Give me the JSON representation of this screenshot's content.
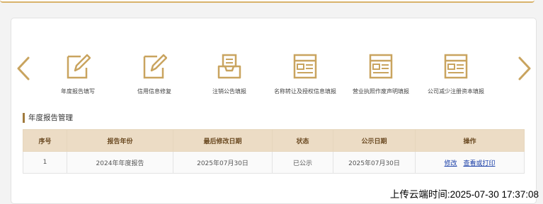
{
  "carousel": {
    "items": [
      {
        "label": "年度报告填写",
        "icon": "document-pen-icon"
      },
      {
        "label": "信用信息修复",
        "icon": "document-pen-icon"
      },
      {
        "label": "注销公告填报",
        "icon": "inbox-tray-icon"
      },
      {
        "label": "名称转让及授权信息填报",
        "icon": "form-card-icon"
      },
      {
        "label": "营业执照作废声明填报",
        "icon": "form-card-icon"
      },
      {
        "label": "公司减少注册资本填报",
        "icon": "form-card-icon"
      }
    ],
    "accent_color": "#c9a45f"
  },
  "section": {
    "title": "年度报告管理"
  },
  "table": {
    "headers": [
      "序号",
      "报告年份",
      "最后修改日期",
      "状态",
      "公示日期",
      "操作"
    ],
    "rows": [
      {
        "index": "1",
        "year": "2024年年度报告",
        "modified": "2025年07月30日",
        "status": "已公示",
        "published": "2025年07月30日",
        "actions": [
          "修改",
          "查看或打印"
        ]
      }
    ]
  },
  "footer": {
    "upload_time": "上传云端时间:2025-07-30 17:37:08"
  }
}
